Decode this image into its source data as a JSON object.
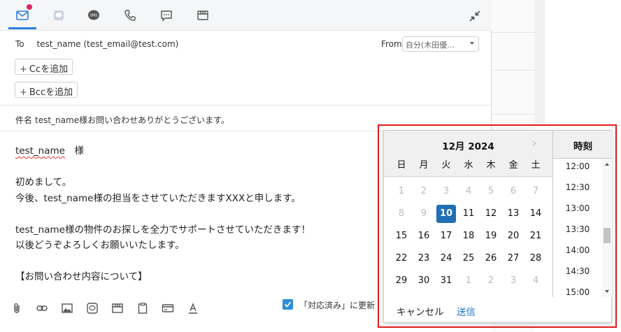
{
  "compose": {
    "to_label": "To",
    "to_value": "test_name (test_email@test.com)",
    "from_label": "From",
    "from_value": "自分(木田優…",
    "add_cc": "Ccを追加",
    "add_bcc": "Bccを追加",
    "subject_label": "件名",
    "subject_value": "test_name様お問い合わせありがとうございます。",
    "body": {
      "greeting_name": "test_name",
      "greeting_suffix": "　様",
      "line_1": "初めまして。",
      "line_2": "今後、test_name様の担当をさせていただきますXXXと申します。",
      "line_3": "test_name様の物件のお探しを全力でサポートさせていただきます！",
      "line_4": "以後どうぞよろしくお願いいたします。",
      "line_5": "【お問い合わせ内容について】"
    },
    "done_checkbox_label": "「対応済み」に更新",
    "done_checked": true
  },
  "tabs": [
    "email-icon",
    "line-icon",
    "sms-icon",
    "phone-icon",
    "chat-icon",
    "store-icon"
  ],
  "toolbar_icons": [
    "paperclip-icon",
    "link-icon",
    "image-icon",
    "line-icon",
    "store-icon",
    "clipboard-icon",
    "card-icon",
    "text-format-icon"
  ],
  "datepicker": {
    "month_label": "12月 2024",
    "weekdays": [
      "日",
      "月",
      "火",
      "水",
      "木",
      "金",
      "土"
    ],
    "weeks": [
      [
        "1",
        "2",
        "3",
        "4",
        "5",
        "6",
        "7"
      ],
      [
        "8",
        "9",
        "10",
        "11",
        "12",
        "13",
        "14"
      ],
      [
        "15",
        "16",
        "17",
        "18",
        "19",
        "20",
        "21"
      ],
      [
        "22",
        "23",
        "24",
        "25",
        "26",
        "27",
        "28"
      ],
      [
        "29",
        "30",
        "31",
        "1",
        "2",
        "3",
        "4"
      ]
    ],
    "selected_day": "10",
    "time_header": "時刻",
    "times": [
      "12:00",
      "12:30",
      "13:00",
      "13:30",
      "14:00",
      "14:30",
      "15:00"
    ],
    "cancel_label": "キャンセル",
    "send_label": "送信"
  },
  "colors": {
    "accent": "#1f6fb3",
    "highlight": "#e41b1b",
    "link": "#1f78c8",
    "checkbox": "#2a8fd6",
    "notification_dot": "#e0245e"
  }
}
